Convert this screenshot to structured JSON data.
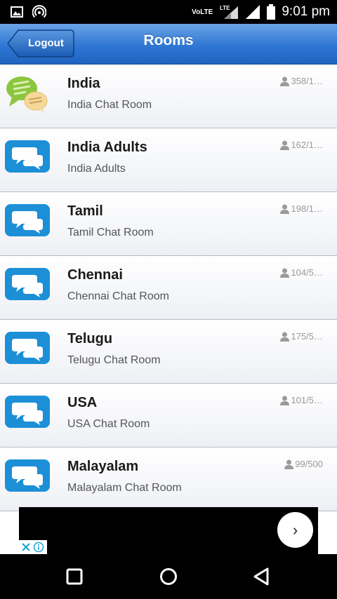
{
  "status_bar": {
    "network_label": "VoLTE",
    "lte_label": "LTE",
    "time": "9:01 pm",
    "icons": [
      "image-notification-icon",
      "hotspot-icon",
      "signal-icon",
      "battery-icon"
    ]
  },
  "header": {
    "title": "Rooms",
    "logout_label": "Logout",
    "bar_color": "#2f77d4"
  },
  "rooms": [
    {
      "name": "India",
      "description": "India Chat Room",
      "users": "358/1…",
      "icon": "chat-bubbles-green-icon"
    },
    {
      "name": "India Adults",
      "description": "India Adults",
      "users": "162/1…",
      "icon": "chat-bubble-blue-icon"
    },
    {
      "name": "Tamil",
      "description": "Tamil Chat Room",
      "users": "198/1…",
      "icon": "chat-bubble-blue-icon"
    },
    {
      "name": "Chennai",
      "description": "Chennai Chat Room",
      "users": "104/5…",
      "icon": "chat-bubble-blue-icon"
    },
    {
      "name": "Telugu",
      "description": "Telugu Chat Room",
      "users": "175/5…",
      "icon": "chat-bubble-blue-icon"
    },
    {
      "name": "USA",
      "description": "USA Chat Room",
      "users": "101/5…",
      "icon": "chat-bubble-blue-icon"
    },
    {
      "name": "Malayalam",
      "description": "Malayalam Chat Room",
      "users": "99/500",
      "icon": "chat-bubble-blue-icon"
    }
  ],
  "ad": {
    "next_glyph": "›",
    "icons": [
      "ad-close-icon",
      "ad-info-icon"
    ]
  },
  "nav_bar": {
    "icons": [
      "recents-square-icon",
      "home-circle-icon",
      "back-triangle-icon"
    ]
  }
}
